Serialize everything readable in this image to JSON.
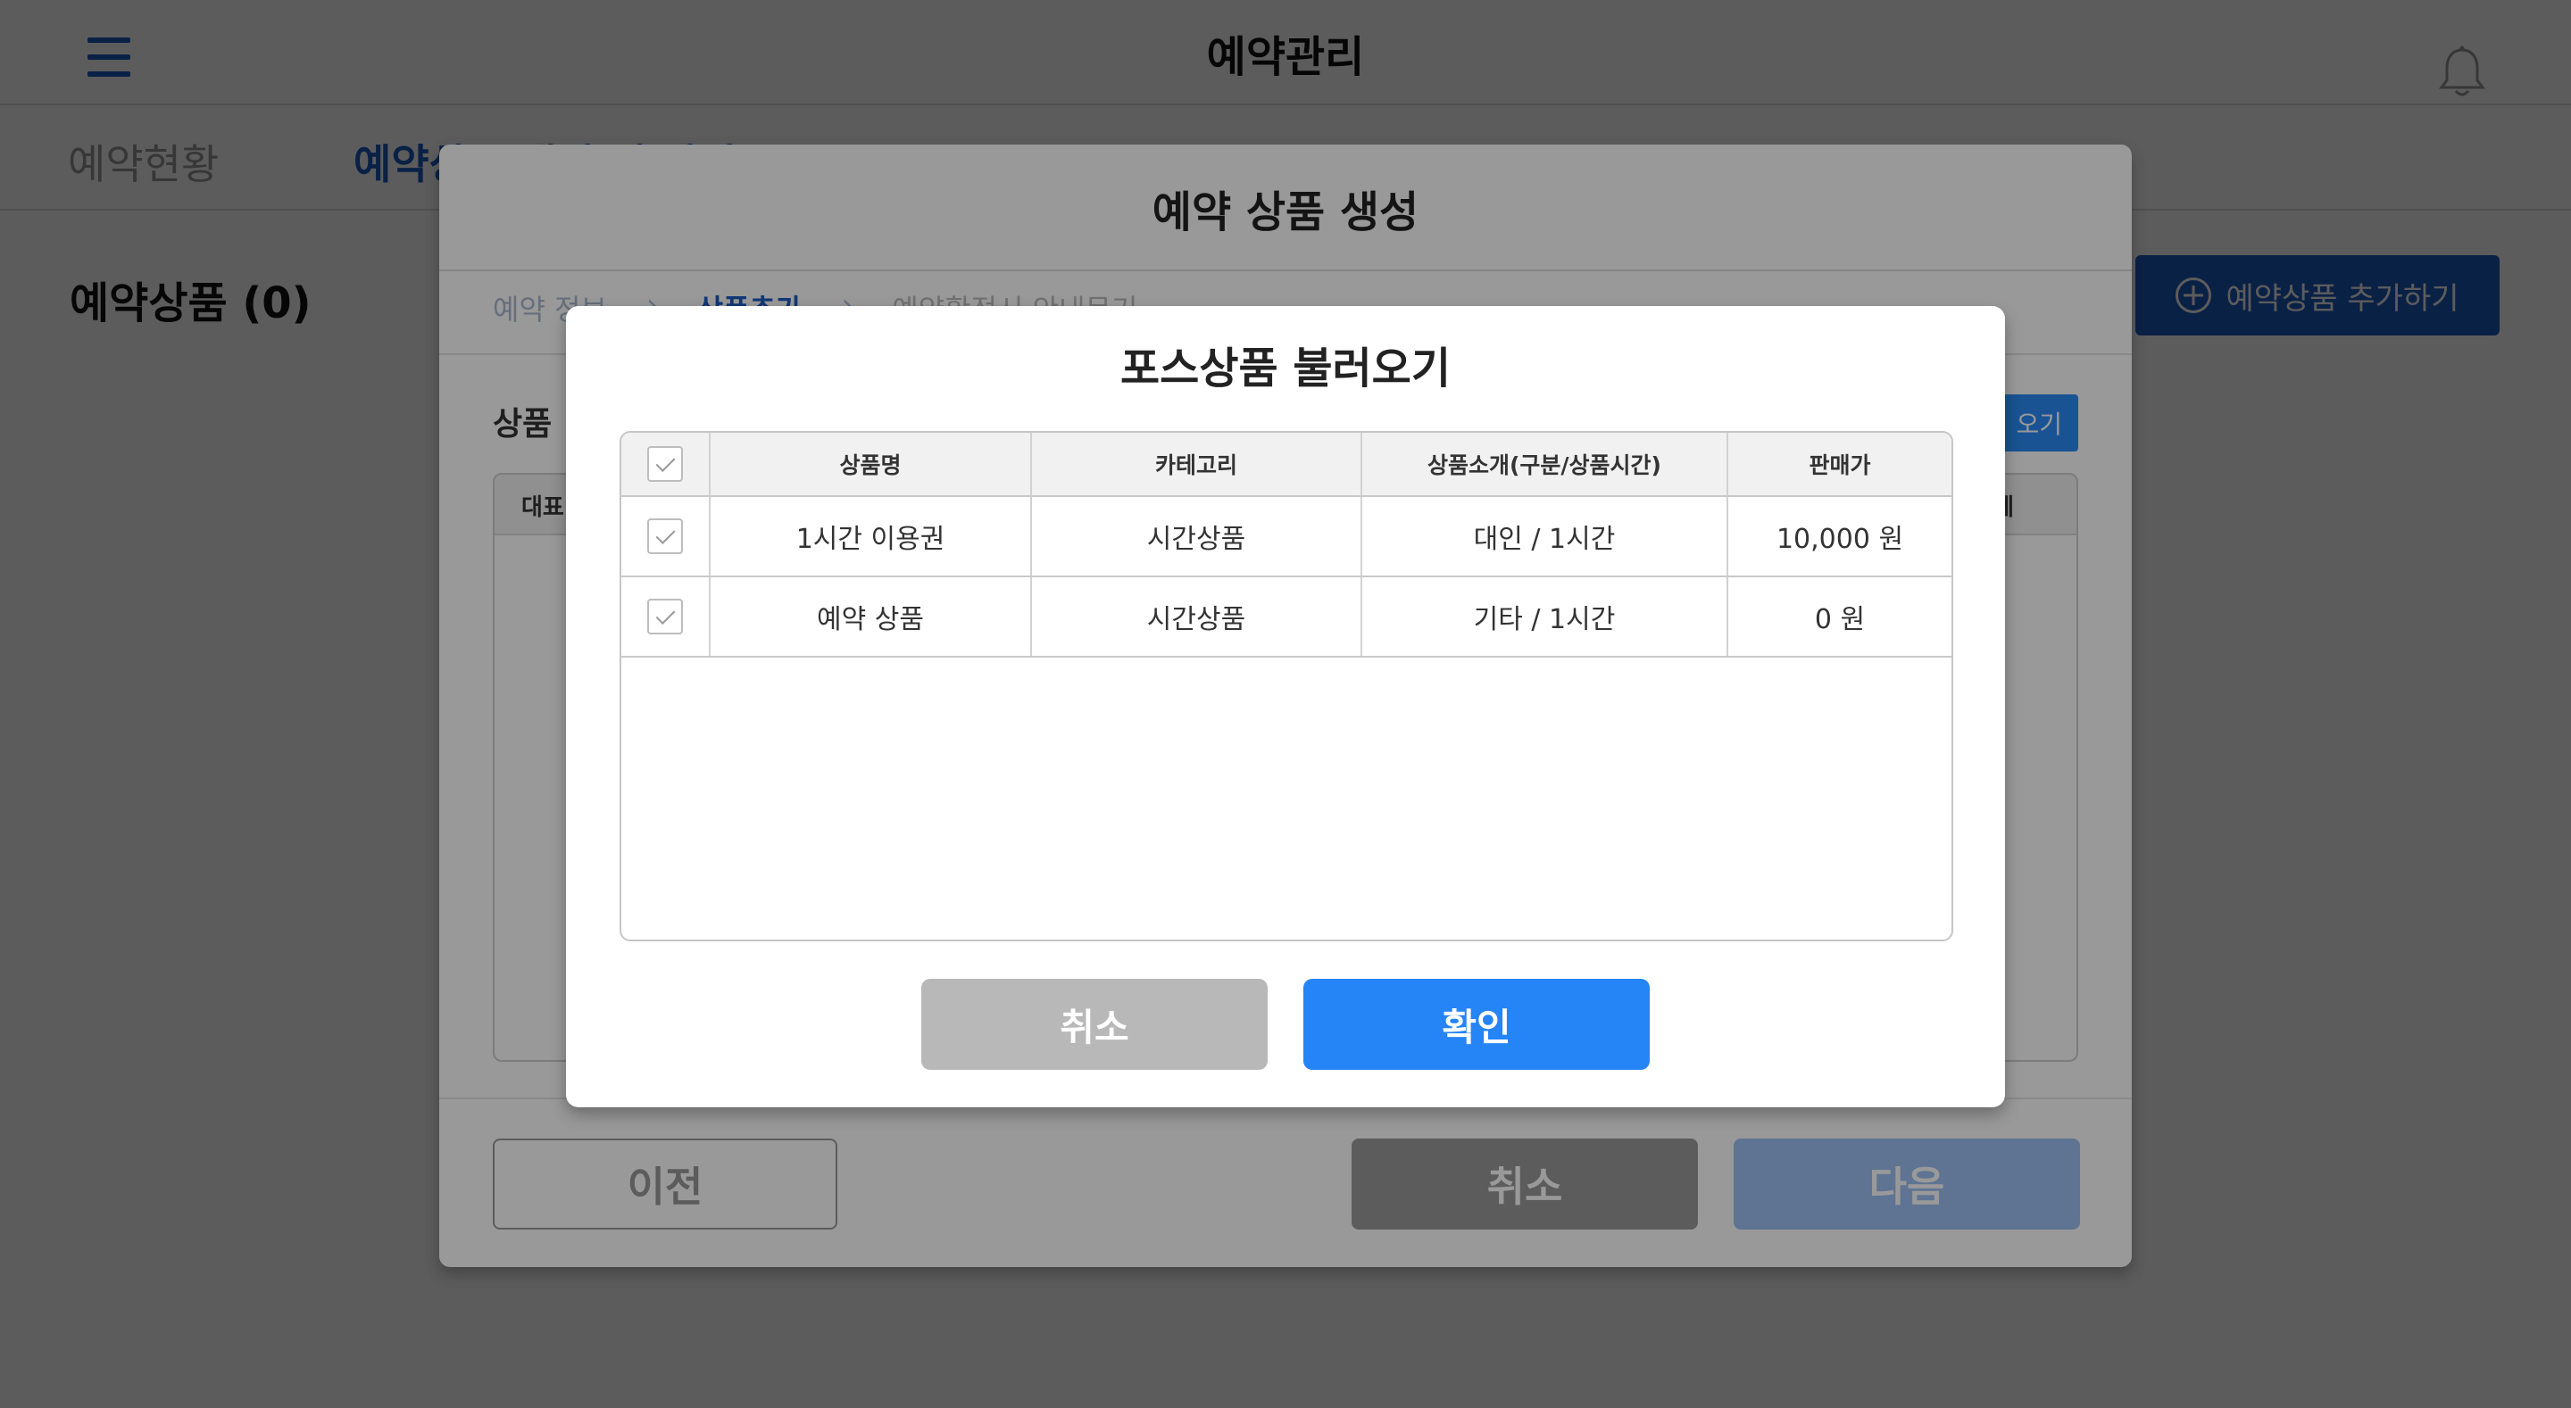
{
  "app": {
    "title": "예약관리",
    "tabs": [
      {
        "label": "예약현황"
      },
      {
        "label": "예약상품 생성 및 관리"
      }
    ],
    "page_heading": "예약상품 (0)",
    "add_button": "예약상품 추가하기"
  },
  "outer_modal": {
    "title": "예약 상품 생성",
    "steps": [
      "예약 정보",
      "상품추가",
      "예약확정시 안내문기"
    ],
    "section_label": "상품",
    "load_button": "오기",
    "table_headers": {
      "left": "대표",
      "right": "제"
    },
    "buttons": {
      "prev": "이전",
      "cancel": "취소",
      "next": "다음"
    }
  },
  "dialog": {
    "title": "포스상품 불러오기",
    "headers": {
      "name": "상품명",
      "category": "카테고리",
      "intro": "상품소개(구분/상품시간)",
      "price": "판매가"
    },
    "rows": [
      {
        "name": "1시간 이용권",
        "category": "시간상품",
        "intro": "대인 / 1시간",
        "price": "10,000 원"
      },
      {
        "name": "예약 상품",
        "category": "시간상품",
        "intro": "기타 / 1시간",
        "price": "0 원"
      }
    ],
    "buttons": {
      "cancel": "취소",
      "confirm": "확인"
    }
  },
  "colors": {
    "brand_blue": "#1f5cc4",
    "confirm_blue": "#2584f6",
    "cancel_gray": "#b8b8b8"
  }
}
